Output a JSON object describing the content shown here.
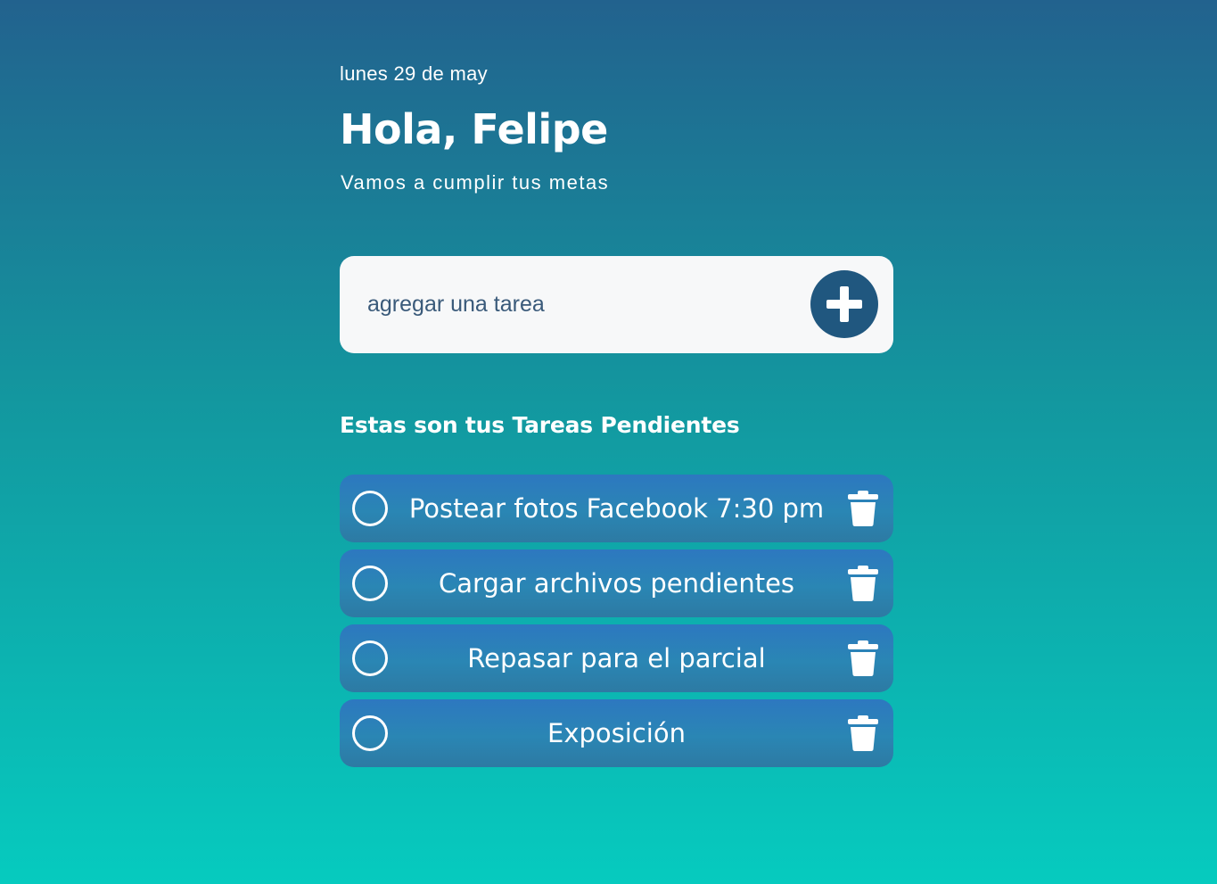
{
  "header": {
    "date": "lunes 29 de may",
    "greeting": "Hola, Felipe",
    "subtitle": "Vamos a cumplir tus metas"
  },
  "add_task": {
    "placeholder": "agregar una tarea",
    "button_icon": "plus-circle-icon"
  },
  "tasks_section": {
    "title": "Estas son tus Tareas Pendientes",
    "items": [
      {
        "label": "Postear fotos Facebook 7:30 pm",
        "completed": false
      },
      {
        "label": "Cargar archivos pendientes",
        "completed": false
      },
      {
        "label": "Repasar para el parcial",
        "completed": false
      },
      {
        "label": "Exposición",
        "completed": false
      }
    ]
  },
  "colors": {
    "background_top": "#22628e",
    "background_bottom": "#06cbbf",
    "task_card": "#2d78c0",
    "add_button": "#20577f",
    "input_background": "#f7f8f9"
  }
}
